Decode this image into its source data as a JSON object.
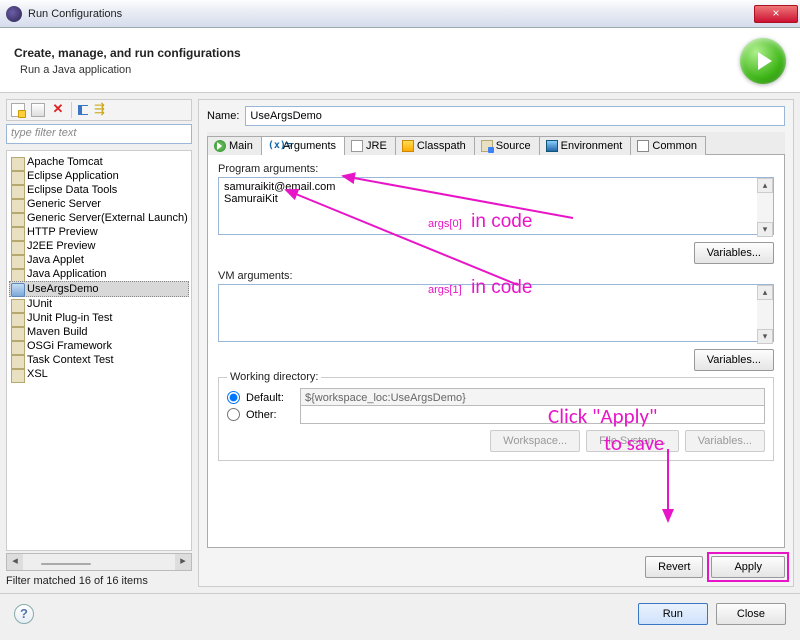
{
  "window": {
    "title": "Run Configurations"
  },
  "header": {
    "title": "Create, manage, and run configurations",
    "subtitle": "Run a Java application"
  },
  "sidebar": {
    "filter_placeholder": "type filter text",
    "items": [
      {
        "label": "Apache Tomcat"
      },
      {
        "label": "Eclipse Application"
      },
      {
        "label": "Eclipse Data Tools"
      },
      {
        "label": "Generic Server"
      },
      {
        "label": "Generic Server(External Launch)"
      },
      {
        "label": "HTTP Preview"
      },
      {
        "label": "J2EE Preview"
      },
      {
        "label": "Java Applet"
      },
      {
        "label": "Java Application"
      },
      {
        "label": "UseArgsDemo",
        "java": true,
        "selected": true
      },
      {
        "label": "JUnit"
      },
      {
        "label": "JUnit Plug-in Test"
      },
      {
        "label": "Maven Build"
      },
      {
        "label": "OSGi Framework"
      },
      {
        "label": "Task Context Test"
      },
      {
        "label": "XSL"
      }
    ],
    "status": "Filter matched 16 of 16 items"
  },
  "form": {
    "name_label": "Name:",
    "name_value": "UseArgsDemo",
    "tabs": [
      "Main",
      "Arguments",
      "JRE",
      "Classpath",
      "Source",
      "Environment",
      "Common"
    ],
    "active_tab": 1,
    "program_args_label": "Program arguments:",
    "program_args_value": "samuraikit@email.com\nSamuraiKit",
    "vm_args_label": "VM arguments:",
    "vm_args_value": "",
    "variables_label": "Variables...",
    "working_dir_label": "Working directory:",
    "default_label": "Default:",
    "default_value": "${workspace_loc:UseArgsDemo}",
    "other_label": "Other:",
    "workspace_btn": "Workspace...",
    "filesystem_btn": "File System...",
    "revert": "Revert",
    "apply": "Apply"
  },
  "footer": {
    "run": "Run",
    "close": "Close"
  },
  "annotations": {
    "args0": "args[0]",
    "args1": "args[1]",
    "incode": "in code",
    "apply1": "Click \"Apply\"",
    "apply2": "to save"
  }
}
